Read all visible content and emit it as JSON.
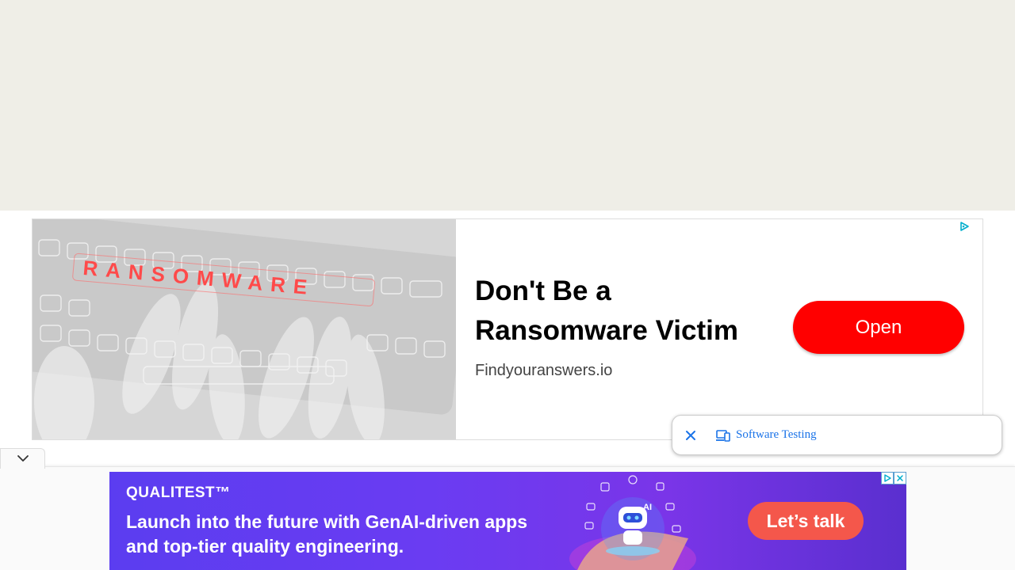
{
  "ad": {
    "title": "Don't Be a Ransomware Victim",
    "domain": "Findyouranswers.io",
    "cta": "Open",
    "image_caption": "RANSOMWARE",
    "accent_color": "#ff0000"
  },
  "search_chip": {
    "label": "Software Testing",
    "close_icon": "close-icon",
    "devices_icon": "devices-icon"
  },
  "bottom_banner": {
    "brand": "QUALITEST™",
    "headline": "Launch into the future with GenAI-driven apps and top-tier quality engineering.",
    "cta": "Let’s talk",
    "cta_color": "#f4574b",
    "ai_label": "AI"
  }
}
